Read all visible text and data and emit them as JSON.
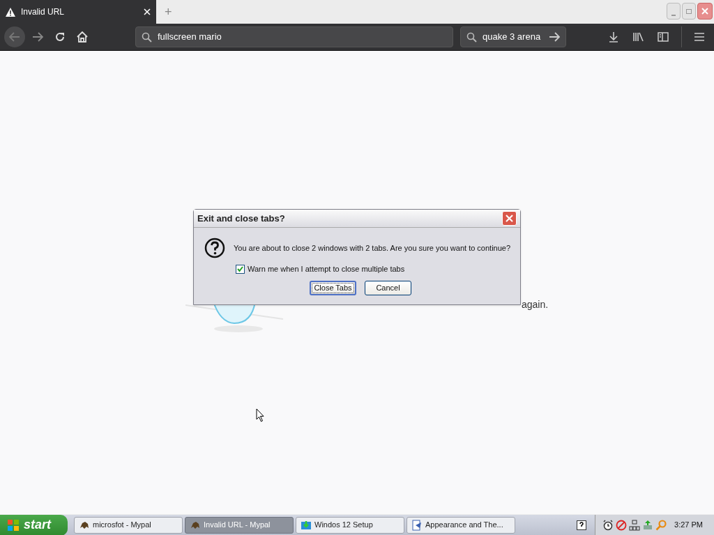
{
  "browser": {
    "tabs": [
      {
        "title": "Invalid URL",
        "selected": true
      }
    ],
    "new_tab": "+",
    "address": {
      "value": "fullscreen mario"
    },
    "search": {
      "value": "quake 3 arena"
    }
  },
  "page": {
    "message": "again."
  },
  "dialog": {
    "title": "Exit and close tabs?",
    "message": "You are about to close 2 windows with 2 tabs. Are you sure you want to continue?",
    "checkbox": {
      "label": "Warn me when I attempt to close multiple tabs",
      "checked": true
    },
    "buttons": [
      {
        "label": "Close Tabs",
        "selected": true
      },
      {
        "label": "Cancel",
        "selected": false
      }
    ]
  },
  "taskbar": {
    "start": "start",
    "items": [
      {
        "label": "microsfot - Mypal",
        "selected": false,
        "kind": "browser"
      },
      {
        "label": "Invalid URL - Mypal",
        "selected": true,
        "kind": "browser"
      },
      {
        "label": "Windos 12 Setup",
        "selected": false,
        "kind": "setup"
      },
      {
        "label": "Appearance and The...",
        "selected": false,
        "kind": "control"
      }
    ],
    "clock": "3:27 PM"
  }
}
